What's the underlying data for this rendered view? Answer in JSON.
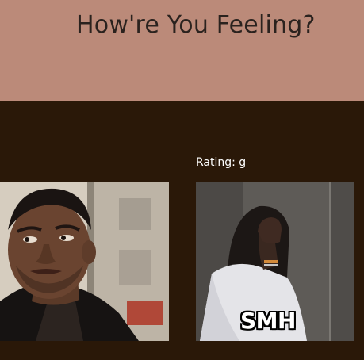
{
  "header": {
    "title": "How're You Feeling?"
  },
  "results": [
    {
      "rating_label": "Rating: g",
      "caption": "SMH"
    }
  ]
}
